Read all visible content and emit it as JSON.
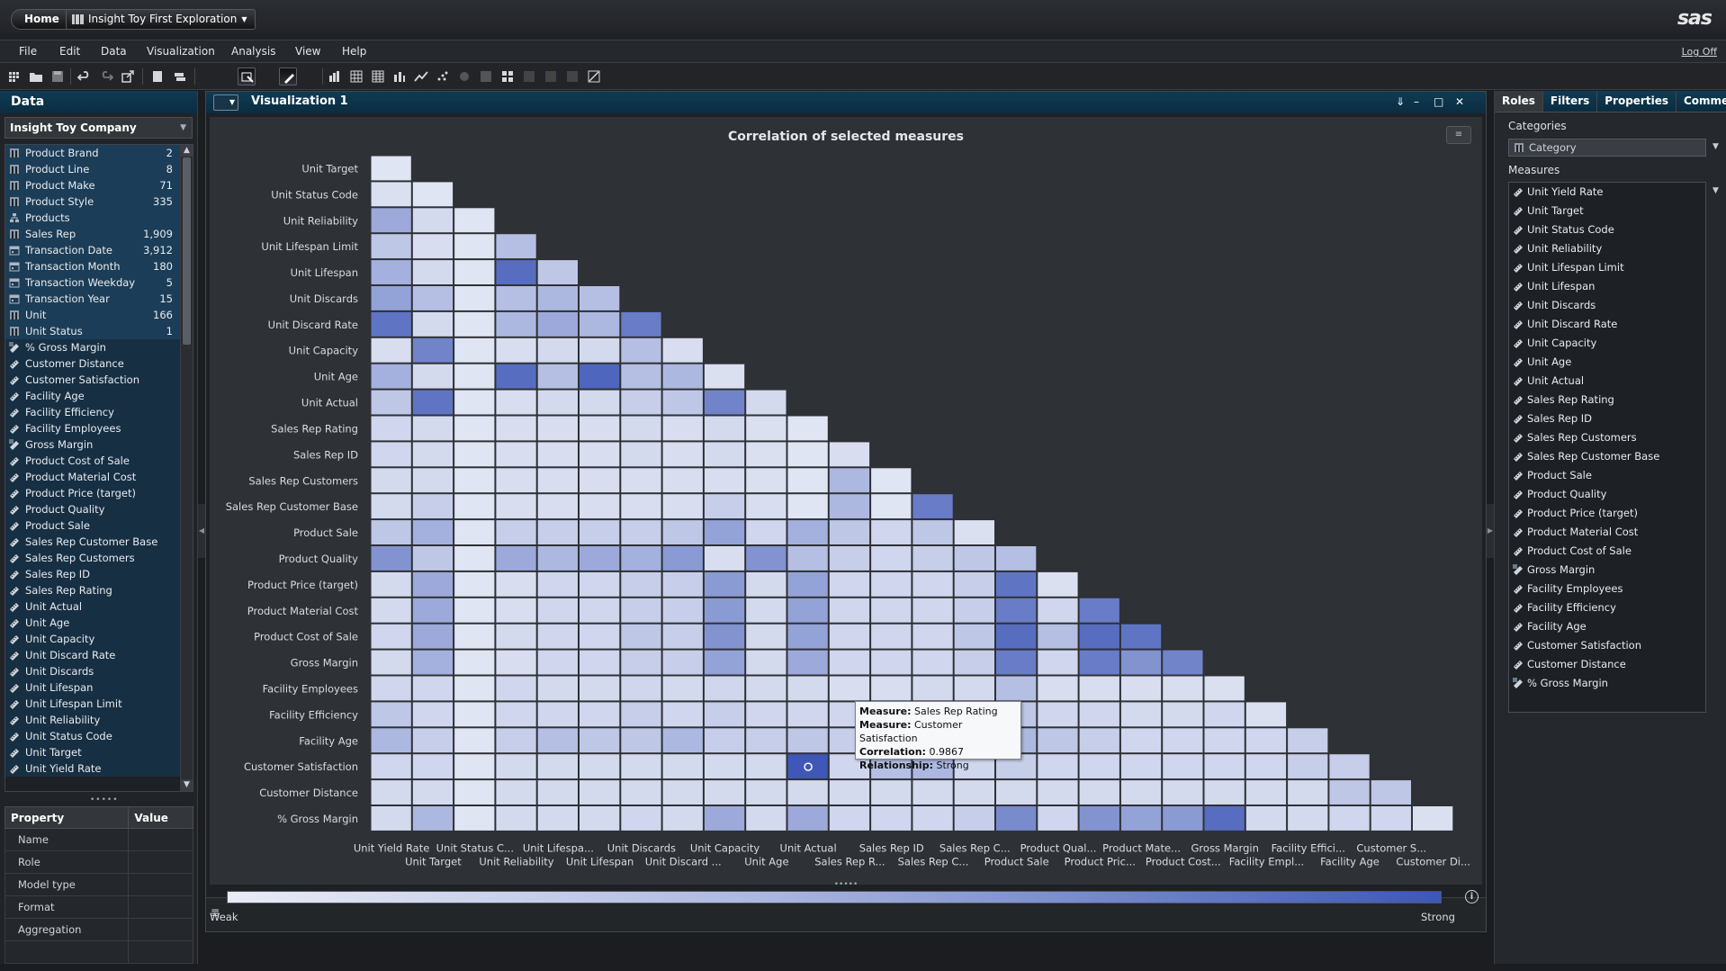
{
  "topbar": {
    "home_label": "Home",
    "report_tab_label": "Insight Toy First Exploration",
    "brand_logo": "sas",
    "logoff_label": "Log Off"
  },
  "menu": [
    "File",
    "Edit",
    "Data",
    "Visualization",
    "Analysis",
    "View",
    "Help"
  ],
  "data_pane": {
    "title": "Data",
    "data_source": "Insight Toy Company",
    "items": [
      {
        "label": "Product Brand",
        "count": "2",
        "kind": "category"
      },
      {
        "label": "Product Line",
        "count": "8",
        "kind": "category"
      },
      {
        "label": "Product Make",
        "count": "71",
        "kind": "category"
      },
      {
        "label": "Product Style",
        "count": "335",
        "kind": "category"
      },
      {
        "label": "Products",
        "count": "",
        "kind": "hierarchy"
      },
      {
        "label": "Sales Rep",
        "count": "1,909",
        "kind": "category"
      },
      {
        "label": "Transaction Date",
        "count": "3,912",
        "kind": "date"
      },
      {
        "label": "Transaction Month",
        "count": "180",
        "kind": "date"
      },
      {
        "label": "Transaction Weekday",
        "count": "5",
        "kind": "date"
      },
      {
        "label": "Transaction Year",
        "count": "15",
        "kind": "date"
      },
      {
        "label": "Unit",
        "count": "166",
        "kind": "category"
      },
      {
        "label": "Unit Status",
        "count": "1",
        "kind": "category"
      },
      {
        "label": "% Gross Margin",
        "count": "",
        "kind": "calc-measure"
      },
      {
        "label": "Customer Distance",
        "count": "",
        "kind": "measure"
      },
      {
        "label": "Customer Satisfaction",
        "count": "",
        "kind": "measure"
      },
      {
        "label": "Facility Age",
        "count": "",
        "kind": "measure"
      },
      {
        "label": "Facility Efficiency",
        "count": "",
        "kind": "measure"
      },
      {
        "label": "Facility Employees",
        "count": "",
        "kind": "measure"
      },
      {
        "label": "Gross Margin",
        "count": "",
        "kind": "calc-measure"
      },
      {
        "label": "Product Cost of Sale",
        "count": "",
        "kind": "measure"
      },
      {
        "label": "Product Material Cost",
        "count": "",
        "kind": "measure"
      },
      {
        "label": "Product Price (target)",
        "count": "",
        "kind": "measure"
      },
      {
        "label": "Product Quality",
        "count": "",
        "kind": "measure"
      },
      {
        "label": "Product Sale",
        "count": "",
        "kind": "measure"
      },
      {
        "label": "Sales Rep Customer Base",
        "count": "",
        "kind": "measure"
      },
      {
        "label": "Sales Rep Customers",
        "count": "",
        "kind": "measure"
      },
      {
        "label": "Sales Rep ID",
        "count": "",
        "kind": "measure"
      },
      {
        "label": "Sales Rep Rating",
        "count": "",
        "kind": "measure"
      },
      {
        "label": "Unit Actual",
        "count": "",
        "kind": "measure"
      },
      {
        "label": "Unit Age",
        "count": "",
        "kind": "measure"
      },
      {
        "label": "Unit Capacity",
        "count": "",
        "kind": "measure"
      },
      {
        "label": "Unit Discard Rate",
        "count": "",
        "kind": "measure"
      },
      {
        "label": "Unit Discards",
        "count": "",
        "kind": "measure"
      },
      {
        "label": "Unit Lifespan",
        "count": "",
        "kind": "measure"
      },
      {
        "label": "Unit Lifespan Limit",
        "count": "",
        "kind": "measure"
      },
      {
        "label": "Unit Reliability",
        "count": "",
        "kind": "measure"
      },
      {
        "label": "Unit Status Code",
        "count": "",
        "kind": "measure"
      },
      {
        "label": "Unit Target",
        "count": "",
        "kind": "measure"
      },
      {
        "label": "Unit Yield Rate",
        "count": "",
        "kind": "measure"
      }
    ],
    "property_table": {
      "headers": [
        "Property",
        "Value"
      ],
      "rows": [
        "Name",
        "Role",
        "Model type",
        "Format",
        "Aggregation"
      ]
    }
  },
  "visualization": {
    "title": "Visualization 1",
    "chart_title": "Correlation of selected measures",
    "legend_weak": "Weak",
    "legend_strong": "Strong",
    "tooltip": {
      "measure_label": "Measure:",
      "measure1": "Sales Rep Rating",
      "measure2": "Customer Satisfaction",
      "correlation_label": "Correlation:",
      "correlation": "0.9867",
      "relationship_label": "Relationship:",
      "relationship": "Strong"
    }
  },
  "chart_data": {
    "type": "heatmap",
    "title": "Correlation of selected measures",
    "row_labels": [
      "Unit Target",
      "Unit Status Code",
      "Unit Reliability",
      "Unit Lifespan Limit",
      "Unit Lifespan",
      "Unit Discards",
      "Unit Discard Rate",
      "Unit Capacity",
      "Unit Age",
      "Unit Actual",
      "Sales Rep Rating",
      "Sales Rep ID",
      "Sales Rep Customers",
      "Sales Rep Customer Base",
      "Product Sale",
      "Product Quality",
      "Product Price (target)",
      "Product Material Cost",
      "Product Cost of Sale",
      "Gross Margin",
      "Facility Employees",
      "Facility Efficiency",
      "Facility Age",
      "Customer Satisfaction",
      "Customer Distance",
      "% Gross Margin"
    ],
    "column_labels_top": [
      "Unit Yield Rate",
      "Unit Status C...",
      "Unit Lifespa...",
      "Unit Discards",
      "Unit Capacity",
      "Unit Actual",
      "Sales Rep ID",
      "Sales Rep C...",
      "Product Qual...",
      "Product Mate...",
      "Gross Margin",
      "Facility Effici...",
      "Customer S..."
    ],
    "column_labels_bottom": [
      "Unit Target",
      "Unit Reliability",
      "Unit Lifespan",
      "Unit Discard ...",
      "Unit Age",
      "Sales Rep R...",
      "Sales Rep C...",
      "Product Sale",
      "Product Pric...",
      "Product Cost...",
      "Facility Empl...",
      "Facility Age",
      "Customer Di..."
    ],
    "color_scale": {
      "weak": "#e9ecf6",
      "strong": "#3d57b7"
    },
    "values": [
      [
        0.05
      ],
      [
        0.08,
        0.05
      ],
      [
        0.45,
        0.12,
        0.05
      ],
      [
        0.25,
        0.1,
        0.05,
        0.3
      ],
      [
        0.4,
        0.12,
        0.05,
        0.85,
        0.25
      ],
      [
        0.5,
        0.3,
        0.05,
        0.3,
        0.35,
        0.3
      ],
      [
        0.8,
        0.12,
        0.05,
        0.35,
        0.45,
        0.35,
        0.75
      ],
      [
        0.1,
        0.7,
        0.05,
        0.1,
        0.12,
        0.12,
        0.3,
        0.1
      ],
      [
        0.4,
        0.12,
        0.05,
        0.85,
        0.3,
        0.9,
        0.3,
        0.35,
        0.08
      ],
      [
        0.25,
        0.8,
        0.05,
        0.1,
        0.12,
        0.12,
        0.2,
        0.25,
        0.7,
        0.12
      ],
      [
        0.15,
        0.12,
        0.05,
        0.1,
        0.1,
        0.1,
        0.12,
        0.1,
        0.12,
        0.08,
        0.05
      ],
      [
        0.15,
        0.12,
        0.05,
        0.1,
        0.1,
        0.1,
        0.12,
        0.1,
        0.12,
        0.08,
        0.05,
        0.1
      ],
      [
        0.12,
        0.12,
        0.05,
        0.1,
        0.1,
        0.1,
        0.1,
        0.1,
        0.1,
        0.08,
        0.05,
        0.35,
        0.05
      ],
      [
        0.12,
        0.2,
        0.05,
        0.1,
        0.1,
        0.1,
        0.1,
        0.1,
        0.2,
        0.1,
        0.05,
        0.35,
        0.05,
        0.75
      ],
      [
        0.25,
        0.4,
        0.05,
        0.2,
        0.2,
        0.2,
        0.2,
        0.25,
        0.5,
        0.15,
        0.4,
        0.25,
        0.15,
        0.25,
        0.08
      ],
      [
        0.6,
        0.25,
        0.05,
        0.45,
        0.35,
        0.45,
        0.4,
        0.55,
        0.1,
        0.6,
        0.3,
        0.2,
        0.15,
        0.2,
        0.25,
        0.3
      ],
      [
        0.12,
        0.45,
        0.05,
        0.1,
        0.15,
        0.15,
        0.2,
        0.2,
        0.55,
        0.12,
        0.5,
        0.15,
        0.15,
        0.15,
        0.2,
        0.8,
        0.08
      ],
      [
        0.12,
        0.45,
        0.05,
        0.1,
        0.15,
        0.15,
        0.2,
        0.2,
        0.55,
        0.12,
        0.5,
        0.15,
        0.15,
        0.15,
        0.2,
        0.75,
        0.15,
        0.75
      ],
      [
        0.15,
        0.45,
        0.05,
        0.12,
        0.15,
        0.15,
        0.25,
        0.2,
        0.6,
        0.12,
        0.5,
        0.15,
        0.15,
        0.15,
        0.25,
        0.85,
        0.3,
        0.85,
        0.8
      ],
      [
        0.12,
        0.4,
        0.05,
        0.1,
        0.15,
        0.15,
        0.2,
        0.2,
        0.5,
        0.12,
        0.45,
        0.15,
        0.15,
        0.15,
        0.2,
        0.75,
        0.15,
        0.75,
        0.6,
        0.7
      ],
      [
        0.15,
        0.15,
        0.05,
        0.15,
        0.12,
        0.12,
        0.15,
        0.12,
        0.15,
        0.12,
        0.12,
        0.1,
        0.1,
        0.12,
        0.12,
        0.3,
        0.1,
        0.1,
        0.1,
        0.1,
        0.08
      ],
      [
        0.25,
        0.15,
        0.05,
        0.15,
        0.15,
        0.15,
        0.2,
        0.15,
        0.2,
        0.15,
        0.15,
        0.15,
        0.15,
        0.15,
        0.2,
        0.25,
        0.15,
        0.15,
        0.12,
        0.12,
        0.15,
        0.08
      ],
      [
        0.35,
        0.2,
        0.05,
        0.2,
        0.3,
        0.25,
        0.25,
        0.35,
        0.2,
        0.2,
        0.25,
        0.2,
        0.2,
        0.2,
        0.2,
        0.35,
        0.25,
        0.2,
        0.15,
        0.15,
        0.15,
        0.15,
        0.2
      ],
      [
        0.15,
        0.15,
        0.05,
        0.12,
        0.12,
        0.12,
        0.12,
        0.12,
        0.12,
        0.12,
        0.99,
        0.15,
        0.3,
        0.35,
        0.15,
        0.2,
        0.15,
        0.15,
        0.15,
        0.15,
        0.15,
        0.15,
        0.2,
        0.2
      ],
      [
        0.12,
        0.12,
        0.05,
        0.12,
        0.12,
        0.12,
        0.12,
        0.12,
        0.12,
        0.12,
        0.12,
        0.12,
        0.12,
        0.12,
        0.12,
        0.12,
        0.12,
        0.12,
        0.12,
        0.12,
        0.12,
        0.12,
        0.12,
        0.25,
        0.25
      ],
      [
        0.12,
        0.35,
        0.05,
        0.12,
        0.12,
        0.12,
        0.15,
        0.12,
        0.45,
        0.12,
        0.45,
        0.15,
        0.15,
        0.15,
        0.2,
        0.65,
        0.15,
        0.6,
        0.5,
        0.55,
        0.85,
        0.12,
        0.12,
        0.15,
        0.15,
        0.08
      ]
    ]
  },
  "right_pane": {
    "tabs": [
      "Roles",
      "Filters",
      "Properties",
      "Comments"
    ],
    "categories_label": "Categories",
    "category_value": "Category",
    "measures_label": "Measures",
    "measures": [
      "Unit Yield Rate",
      "Unit Target",
      "Unit Status Code",
      "Unit Reliability",
      "Unit Lifespan Limit",
      "Unit Lifespan",
      "Unit Discards",
      "Unit Discard Rate",
      "Unit Capacity",
      "Unit Age",
      "Unit Actual",
      "Sales Rep Rating",
      "Sales Rep ID",
      "Sales Rep Customers",
      "Sales Rep Customer Base",
      "Product Sale",
      "Product Quality",
      "Product Price (target)",
      "Product Material Cost",
      "Product Cost of Sale",
      "Gross Margin",
      "Facility Employees",
      "Facility Efficiency",
      "Facility Age",
      "Customer Satisfaction",
      "Customer Distance",
      "% Gross Margin"
    ]
  }
}
